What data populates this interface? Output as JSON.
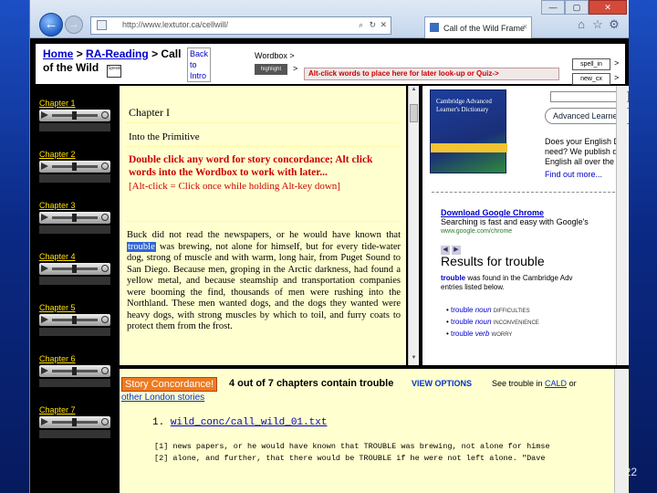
{
  "slide": {
    "number": "22"
  },
  "browser": {
    "url": "http://www.lextutor.ca/cellwill/",
    "tab_title": "Call of the Wild Frame",
    "back_label": "←",
    "forward_label": "→",
    "tab_close": "×",
    "window_controls": {
      "minimize": "—",
      "maximize": "▢",
      "close": "✕"
    },
    "toolbar_icons": [
      "home-icon",
      "star-icon",
      "gear-icon"
    ]
  },
  "header": {
    "crumb_home": "Home",
    "crumb_sep": ">",
    "crumb_ra": "RA-Reading",
    "crumb_call_1": "Call",
    "crumb_call_2": "of the Wild",
    "speak_label": "Speak",
    "back_intro": [
      "Back",
      "to",
      "Intro"
    ],
    "wordbox_label": "Wordbox >",
    "highlight_button": "highlight",
    "highlight_arrow": ">",
    "alt_click_text": "Alt-click words to place here for later look-up or Quiz->",
    "spell_button": "spell_in",
    "spell_arrow": ">",
    "new_button": "new_cx",
    "new_arrow": ">"
  },
  "chapters": [
    {
      "label": "Chapter 1"
    },
    {
      "label": "Chapter 2"
    },
    {
      "label": "Chapter 3"
    },
    {
      "label": "Chapter 4"
    },
    {
      "label": "Chapter 5"
    },
    {
      "label": "Chapter 6"
    },
    {
      "label": "Chapter 7"
    }
  ],
  "reader": {
    "chapter_heading": "Chapter I",
    "chapter_subtitle": "Into the Primitive",
    "instruction": "Double click any word for story concordance; Alt click words into the Wordbox to work with later...",
    "instruction_sub": "[Alt-click = Click once while holding Alt-key down]",
    "text_before": "Buck did not read the newspapers, or he would have known that ",
    "highlighted_word": "trouble",
    "text_after": " was brewing, not alone for himself, but for every tide-water dog, strong of muscle and with warm, long hair, from Puget Sound to San Diego. Because men, groping in the Arctic darkness, had found a yellow metal, and because steamship and transportation companies were booming the find, thousands of men were rushing into the Northland. These men wanted dogs, and the dogs they wanted were heavy dogs, with strong muscles by which to toil, and furry coats to protect them from the frost."
  },
  "dictionary_pane": {
    "cover_title": "Cambridge Advanced Learner's Dictionary",
    "advanced_box": "Advanced Learne",
    "ad_copy": [
      "Does your English D",
      "need? We publish d",
      "English all over the"
    ],
    "find_out": "Find out more...",
    "google_ad_title": "Download Google Chrome",
    "google_ad_text": "Searching is fast and easy with Google's",
    "google_ad_url": "www.google.com/chrome",
    "results_title": "Results for trouble",
    "results_word": "trouble",
    "results_text_1": " was found in the Cambridge Adv",
    "results_text_2": "entries listed below.",
    "entries": [
      {
        "word": "trouble",
        "pos": "noun",
        "gram": "DIFFICULTIES"
      },
      {
        "word": "trouble",
        "pos": "noun",
        "gram": "INCONVENIENCE"
      },
      {
        "word": "trouble",
        "pos": "verb",
        "gram": "WORRY"
      }
    ]
  },
  "concordance": {
    "badge": "Story Concordance!",
    "count_text": "4 out of 7 chapters contain ",
    "count_word": "trouble",
    "view_options": "VIEW OPTIONS",
    "see_prefix": "See trouble in ",
    "see_link": "CALD",
    "see_suffix": " or",
    "other_stories": "other London stories",
    "file_num": "1.",
    "file_link": "wild_conc/call_wild_01.txt",
    "lines": [
      "[1] news papers, or he would have known that TROUBLE was brewing, not alone for himse",
      "[2] alone, and further, that there would be TROUBLE if he were not left alone. \"Dave"
    ]
  }
}
